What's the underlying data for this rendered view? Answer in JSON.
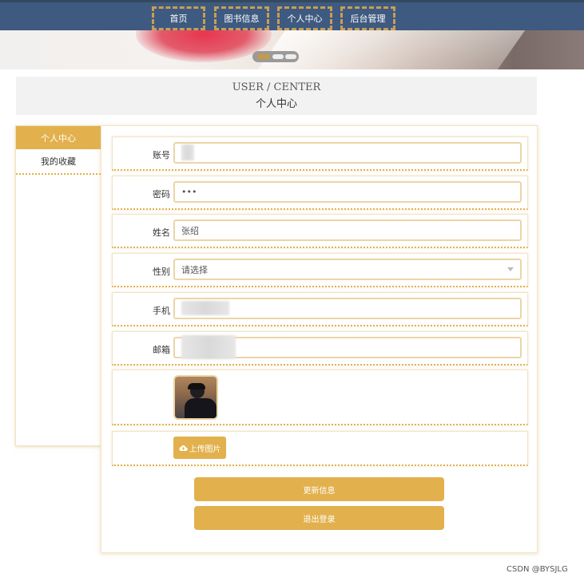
{
  "nav": {
    "items": [
      {
        "label": "首页"
      },
      {
        "label": "图书信息"
      },
      {
        "label": "个人中心"
      },
      {
        "label": "后台管理"
      }
    ]
  },
  "page_title": {
    "en": "USER / CENTER",
    "cn": "个人中心"
  },
  "sidebar": {
    "items": [
      {
        "label": "个人中心",
        "active": true
      },
      {
        "label": "我的收藏",
        "active": false
      }
    ]
  },
  "form": {
    "account": {
      "label": "账号",
      "value": ""
    },
    "password": {
      "label": "密码",
      "value": "•••"
    },
    "name": {
      "label": "姓名",
      "value": "张绍"
    },
    "gender": {
      "label": "性别",
      "value": "请选择"
    },
    "phone": {
      "label": "手机",
      "value": ""
    },
    "email": {
      "label": "邮箱",
      "value": ""
    },
    "upload_label": "上传图片",
    "update_label": "更新信息",
    "logout_label": "退出登录"
  },
  "colors": {
    "nav_bg": "#3e5a80",
    "accent": "#e2b04d",
    "field_border": "#ecd5a6"
  },
  "icons": {
    "upload": "cloud-upload-icon",
    "select": "chevron-down-icon"
  },
  "watermark": "CSDN @BYSJLG"
}
